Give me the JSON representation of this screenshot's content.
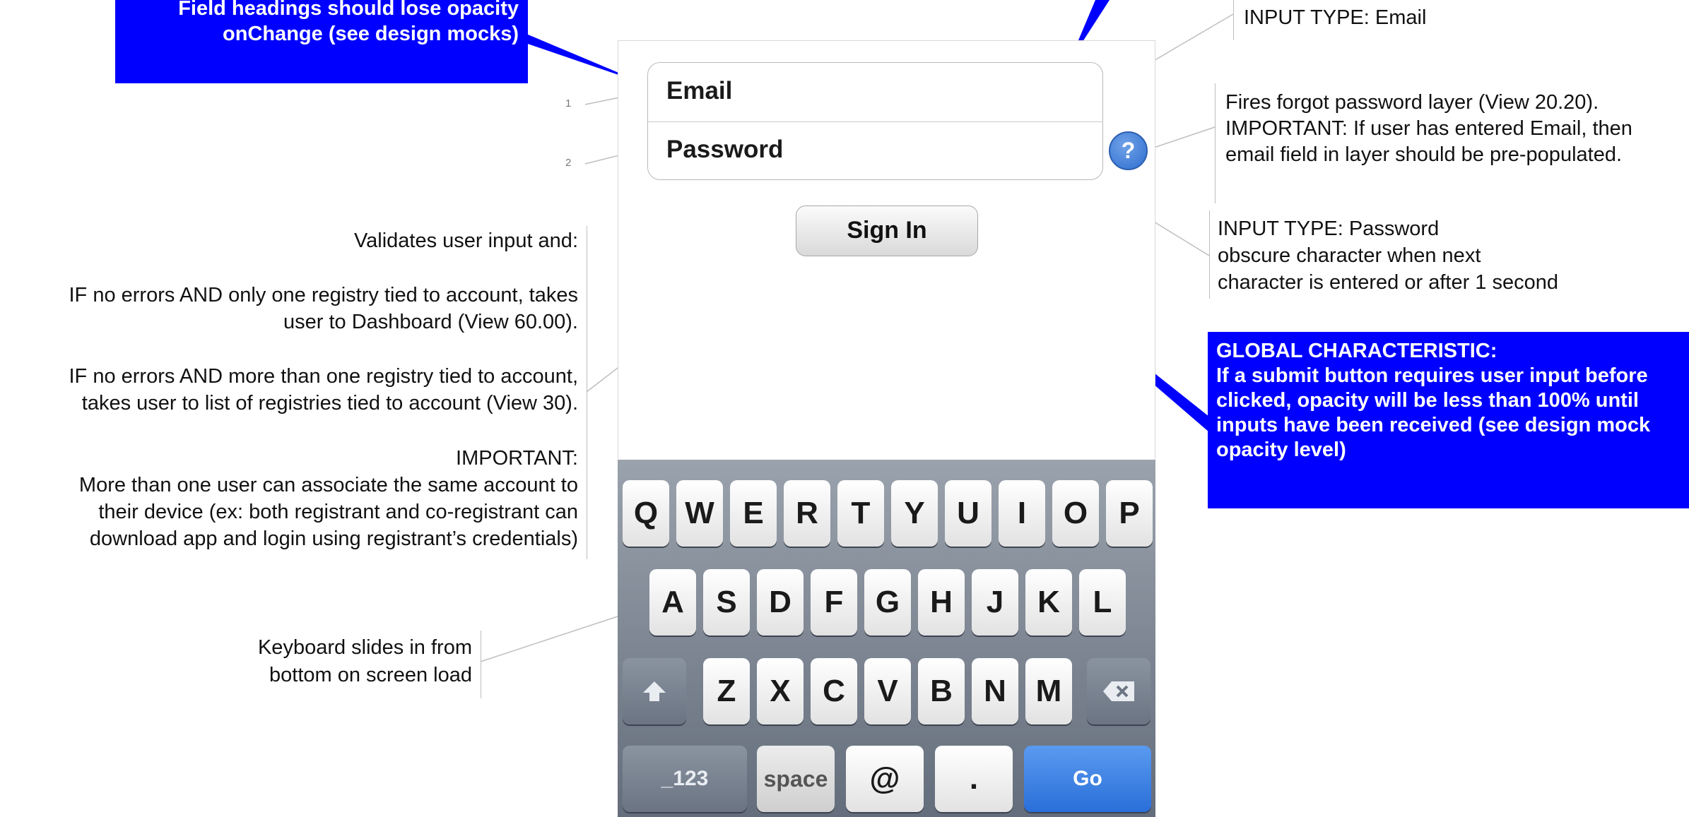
{
  "callouts": {
    "field_headings": {
      "line1": "Field headings should lose opacity",
      "line2": "onChange (see design mocks)"
    },
    "global": {
      "title": "GLOBAL CHARACTERISTIC:",
      "lines": [
        "If a submit button requires user input before",
        "clicked, opacity will be less than 100% until",
        "inputs have been received (see design mock",
        "opacity level)"
      ]
    }
  },
  "form": {
    "email_label": "Email",
    "password_label": "Password",
    "help_label": "?",
    "signin_label": "Sign In"
  },
  "numbers": {
    "n1": "1",
    "n2": "2"
  },
  "notes": {
    "input_email": "INPUT TYPE: Email",
    "forgot_password": [
      "Fires forgot password layer (View 20.20).",
      "IMPORTANT: If user has entered Email, then",
      "email field in layer should be pre-populated."
    ],
    "input_password": [
      "INPUT TYPE: Password",
      "obscure character when next",
      "character is entered or after 1 second"
    ],
    "validate_intro": "Validates user input and:",
    "validate_one": [
      "IF no errors AND only one registry tied to account, takes",
      "user to Dashboard (View 60.00)."
    ],
    "validate_many": [
      "IF no errors AND more than one registry tied to account,",
      "takes user to list of registries tied to account (View 30)."
    ],
    "important": [
      "IMPORTANT:",
      "More than one user can associate the same account to",
      "their device (ex: both registrant and co-registrant can",
      "download app and login using registrant’s credentials)"
    ],
    "keyboard": [
      "Keyboard slides in from",
      "bottom on screen load"
    ]
  },
  "keyboard": {
    "row1": [
      "Q",
      "W",
      "E",
      "R",
      "T",
      "Y",
      "U",
      "I",
      "O",
      "P"
    ],
    "row2": [
      "A",
      "S",
      "D",
      "F",
      "G",
      "H",
      "J",
      "K",
      "L"
    ],
    "row3": [
      "Z",
      "X",
      "C",
      "V",
      "B",
      "N",
      "M"
    ],
    "shift_icon": "shift-arrow-icon",
    "backspace_icon": "backspace-icon",
    "numbers_key": "_123",
    "space_key": "space",
    "at_key": "@",
    "dot_key": ".",
    "go_key": "Go"
  },
  "colors": {
    "callout_blue": "#0000ff",
    "go_blue": "#2a6fd9",
    "help_blue": "#3a78d6"
  }
}
